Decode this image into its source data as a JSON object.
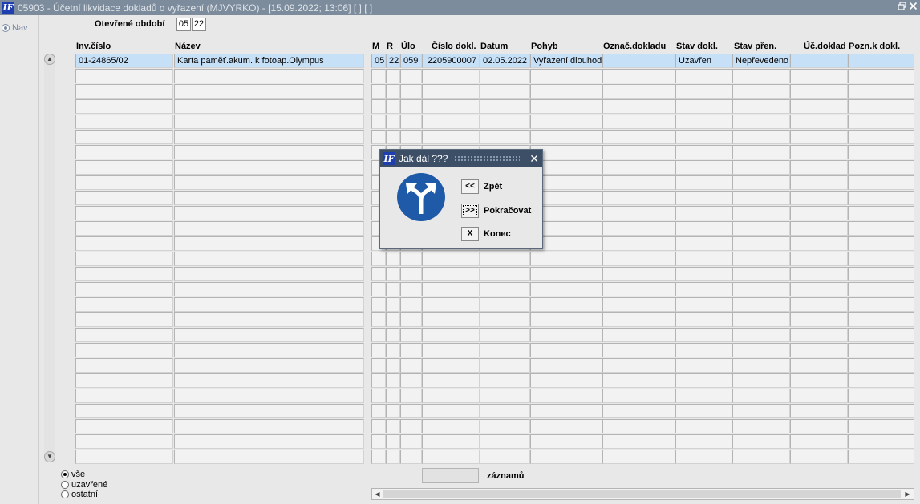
{
  "window": {
    "title": "05903 - Účetní likvidace dokladů o vyřazení (MJVYRKO) - [15.09.2022; 13:06]  [ ]  [ ]",
    "logo": "IF",
    "restore_icon": "restore-icon",
    "close_icon": "close-icon"
  },
  "nav": {
    "label": "Nav"
  },
  "period": {
    "label": "Otevřené období",
    "month": "05",
    "year": "22"
  },
  "columns": {
    "inv": "Inv.číslo",
    "nazev": "Název",
    "m": "M",
    "r": "R",
    "ulo": "Úlo",
    "cislo": "Číslo dokl.",
    "datum": "Datum",
    "pohyb": "Pohyb",
    "oznac": "Označ.dokladu",
    "stav": "Stav dokl.",
    "stavpren": "Stav přen.",
    "ucdoklad": "Úč.doklad",
    "pozn": "Pozn.k dokl."
  },
  "rows": [
    {
      "inv": "01-24865/02",
      "nazev": "Karta paměť.akum. k fotoap.Olympus",
      "m": "05",
      "r": "22",
      "ulo": "059",
      "cislo": "2205900007",
      "datum": "02.05.2022",
      "pohyb": "Vyřazení dlouhod",
      "oznac": "",
      "stav": "Uzavřen",
      "stavpren": "Nepřevedeno",
      "ucdoklad": "",
      "pozn": ""
    }
  ],
  "filter": {
    "options": [
      "vše",
      "uzavřené",
      "ostatní"
    ],
    "selected": "vše"
  },
  "records": {
    "count": "",
    "label": "záznamů"
  },
  "dialog": {
    "title": "Jak dál ???",
    "logo": "IF",
    "icon": "fork-arrows-icon",
    "buttons": [
      {
        "symbol": "<<",
        "label": "Zpět"
      },
      {
        "symbol": ">>",
        "label": "Pokračovat"
      },
      {
        "symbol": "X",
        "label": "Konec"
      }
    ]
  }
}
